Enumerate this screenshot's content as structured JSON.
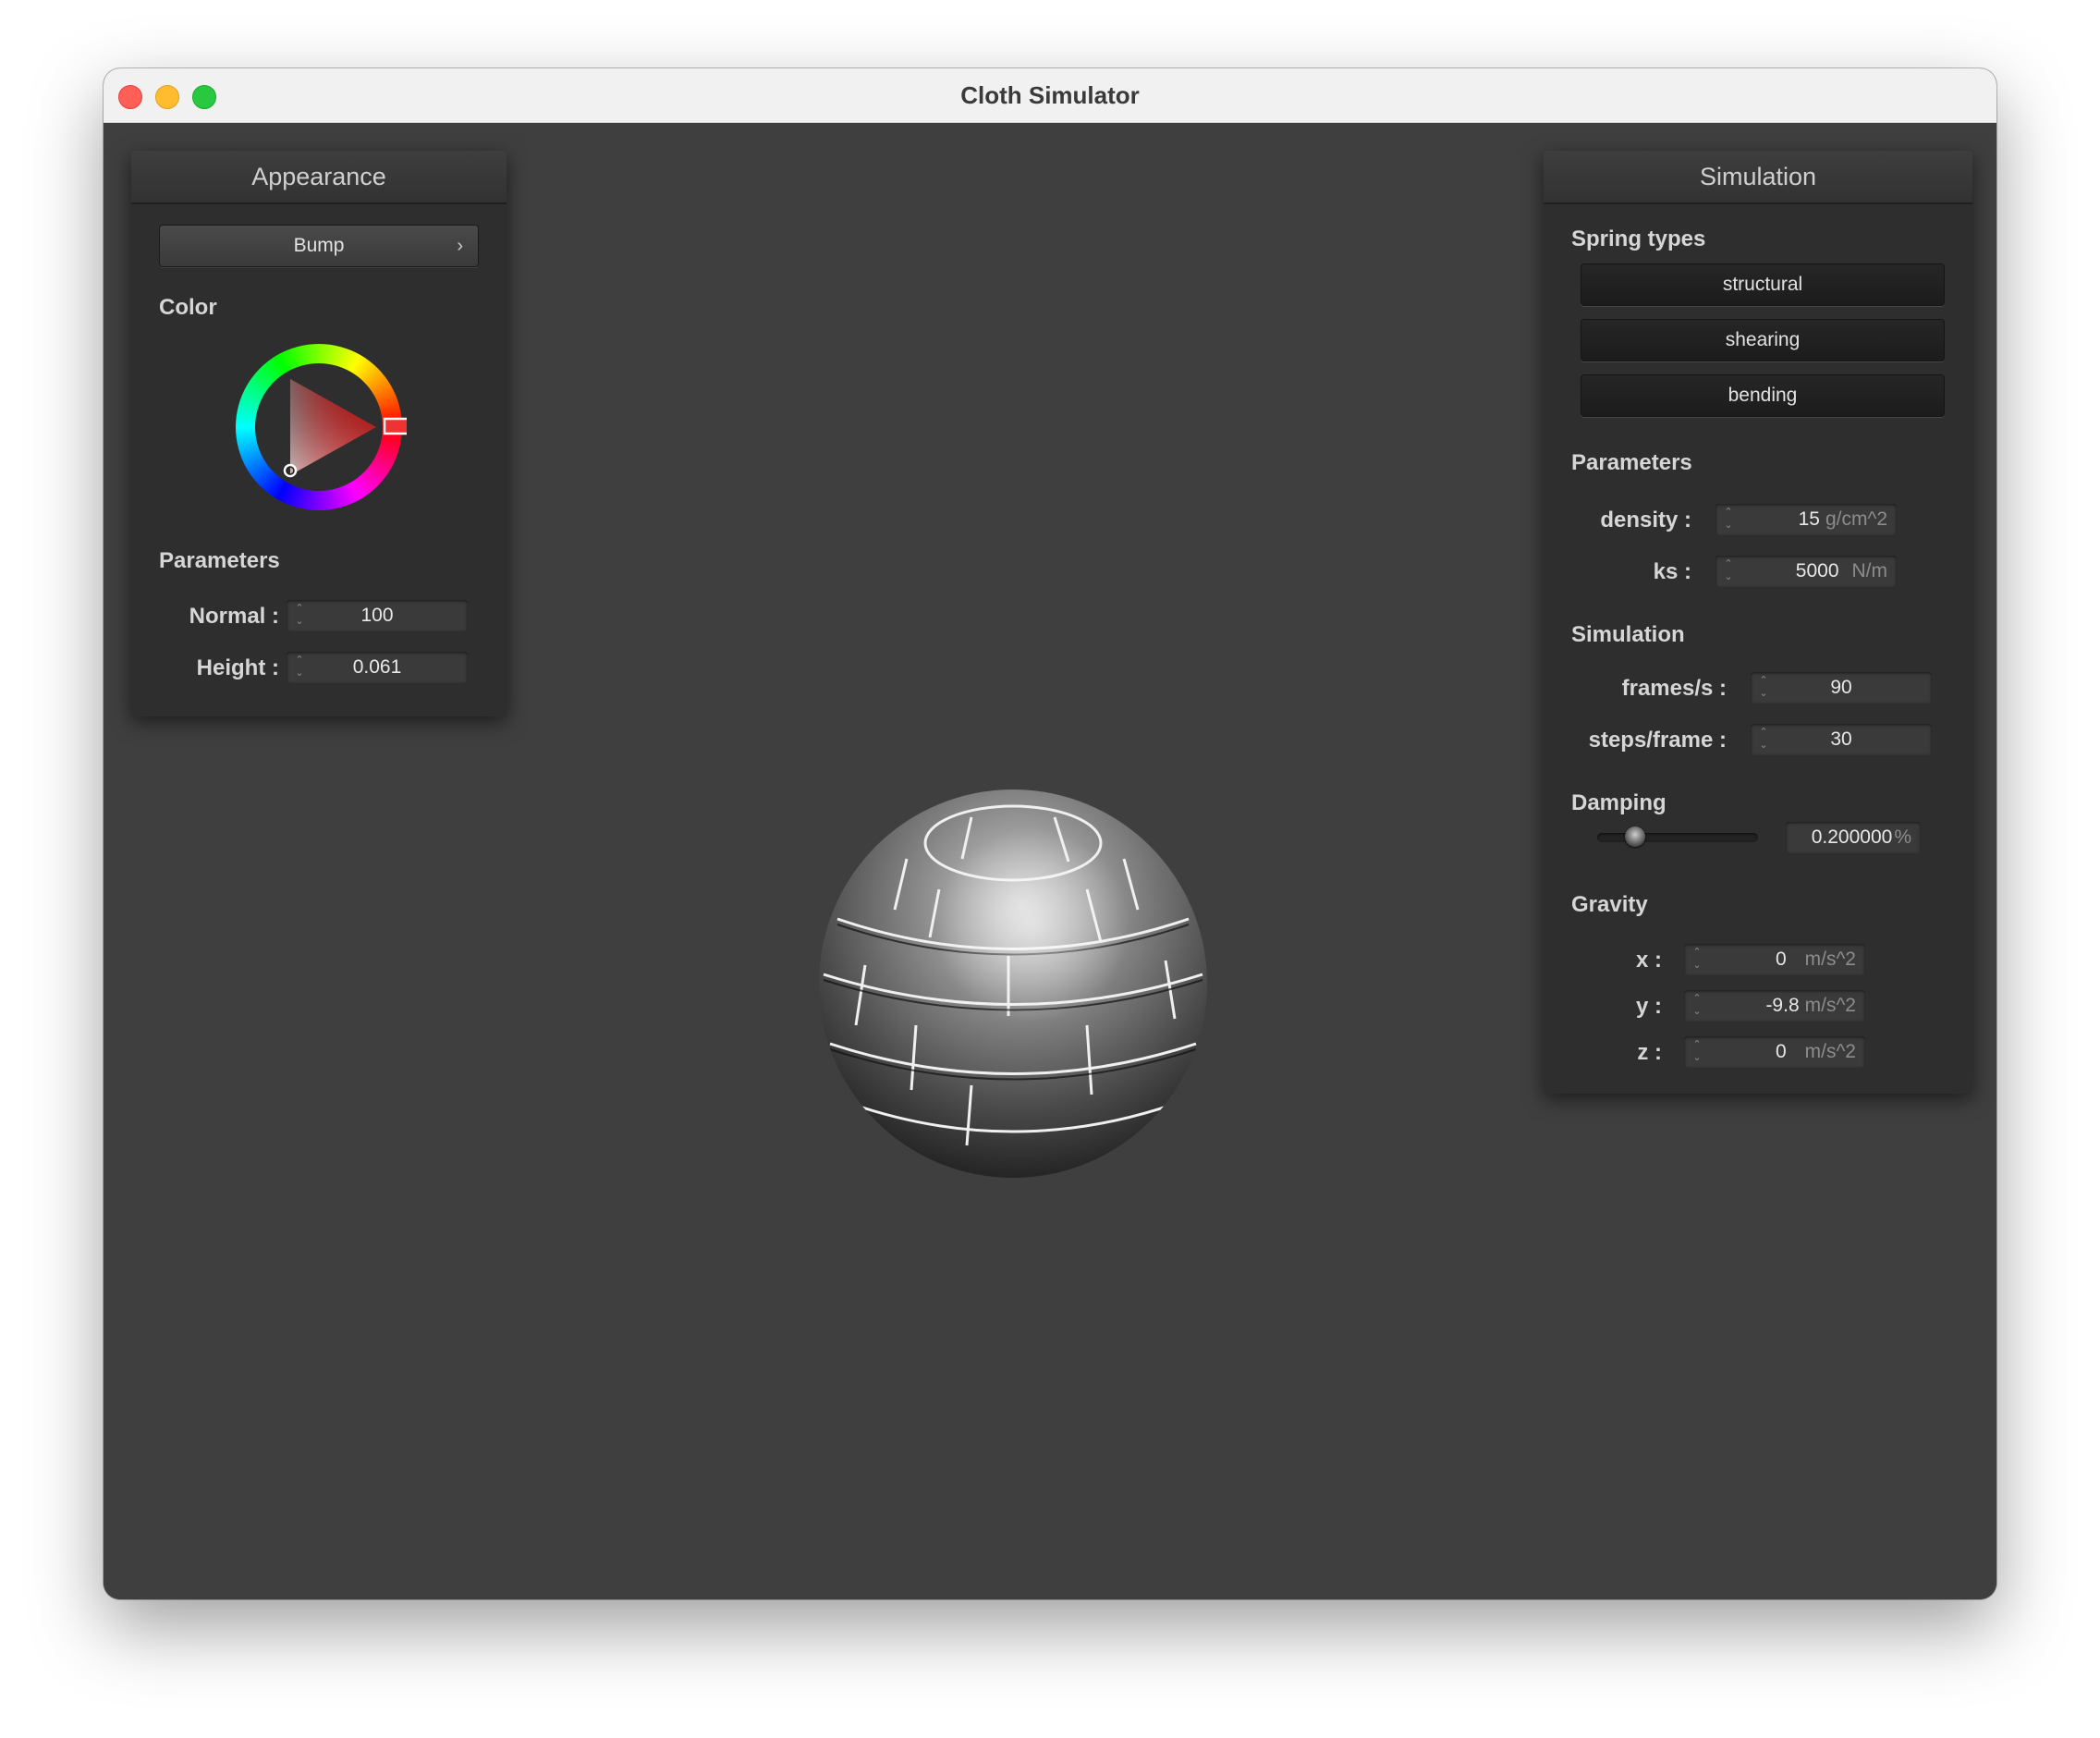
{
  "window": {
    "title": "Cloth Simulator"
  },
  "appearance": {
    "header": "Appearance",
    "shader_dropdown": "Bump",
    "color_label": "Color",
    "parameters_label": "Parameters",
    "normal_label": "Normal :",
    "normal_value": "100",
    "height_label": "Height :",
    "height_value": "0.061"
  },
  "simulation": {
    "header": "Simulation",
    "spring_types_label": "Spring types",
    "spring_buttons": [
      "structural",
      "shearing",
      "bending"
    ],
    "parameters_label": "Parameters",
    "density_label": "density :",
    "density_value": "15",
    "density_unit": "g/cm^2",
    "ks_label": "ks :",
    "ks_value": "5000",
    "ks_unit": "N/m",
    "sim_label": "Simulation",
    "fps_label": "frames/s :",
    "fps_value": "90",
    "steps_label": "steps/frame :",
    "steps_value": "30",
    "damping_label": "Damping",
    "damping_value": "0.200000",
    "damping_unit": "%",
    "damping_slider_fraction": 0.2,
    "gravity_label": "Gravity",
    "gx_label": "x :",
    "gx_value": "0",
    "gy_label": "y :",
    "gy_value": "-9.8",
    "gz_label": "z :",
    "gz_value": "0",
    "gravity_unit": "m/s^2"
  },
  "colors": {
    "selected_color": "#e02020"
  }
}
